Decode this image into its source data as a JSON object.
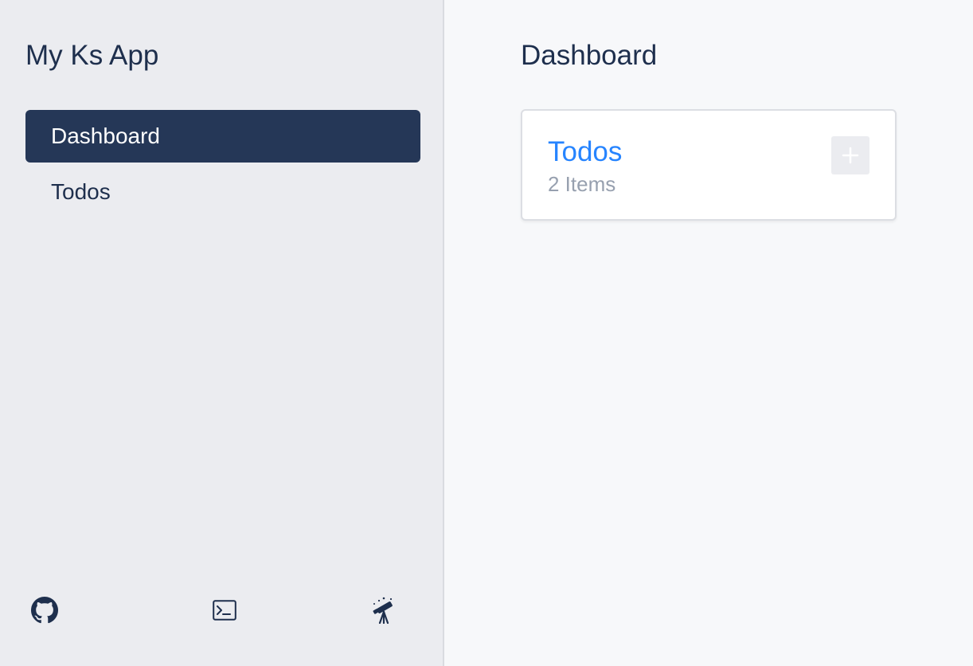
{
  "sidebar": {
    "app_title": "My Ks App",
    "nav": [
      {
        "label": "Dashboard",
        "active": true
      },
      {
        "label": "Todos",
        "active": false
      }
    ],
    "footer_icons": [
      "github-icon",
      "terminal-icon",
      "telescope-icon"
    ]
  },
  "main": {
    "title": "Dashboard",
    "cards": [
      {
        "title": "Todos",
        "count": "2 Items",
        "add_icon": "plus-icon"
      }
    ]
  },
  "colors": {
    "sidebar_bg": "#ebecf0",
    "nav_active_bg": "#253757",
    "text": "#1e2f4d",
    "link": "#2684ff",
    "muted": "#97a0af"
  }
}
